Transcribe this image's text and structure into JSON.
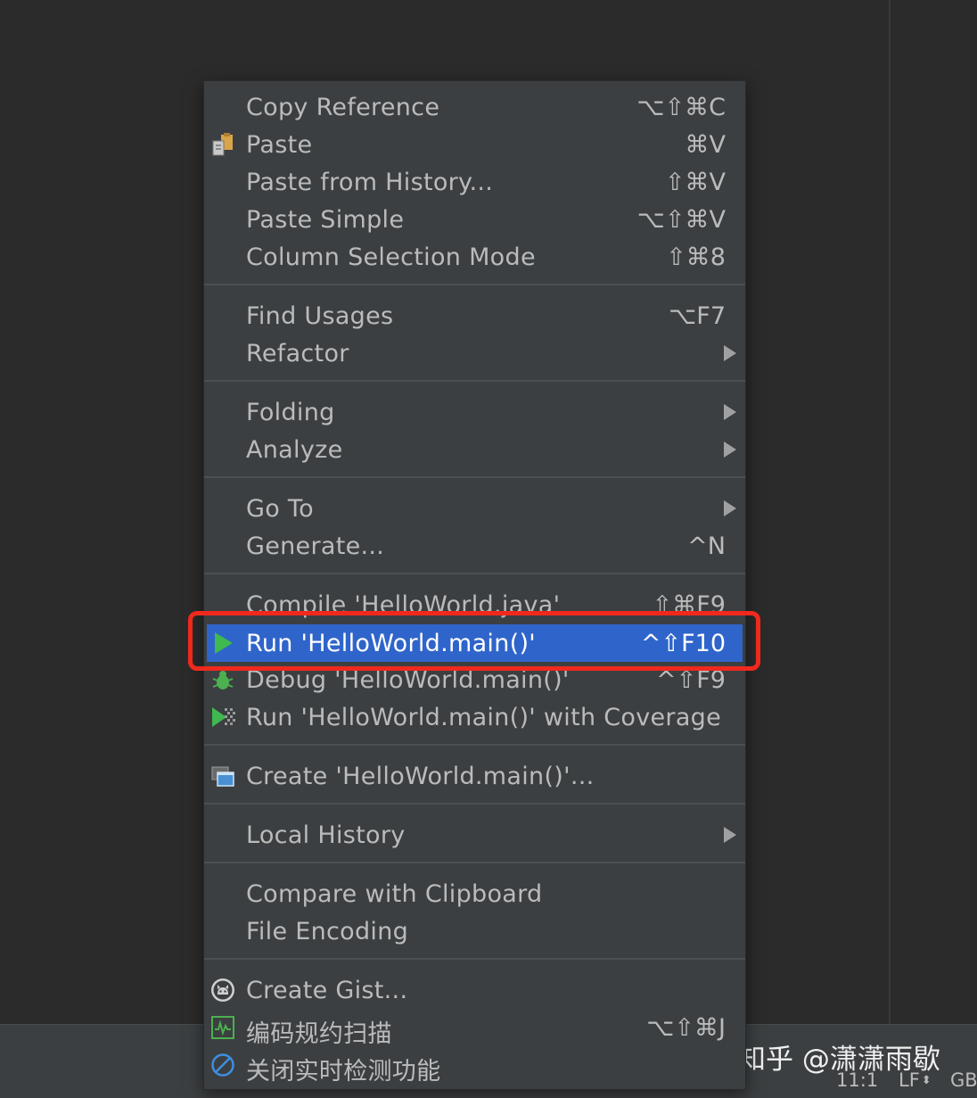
{
  "menu": {
    "items": [
      {
        "label": "Copy Reference",
        "shortcut": "⌥⇧⌘C"
      },
      {
        "label": "Paste",
        "shortcut": "⌘V",
        "icon": "clipboard-paste-icon"
      },
      {
        "label": "Paste from History...",
        "shortcut": "⇧⌘V"
      },
      {
        "label": "Paste Simple",
        "shortcut": "⌥⇧⌘V"
      },
      {
        "label": "Column Selection Mode",
        "shortcut": "⇧⌘8"
      },
      {
        "label": "Find Usages",
        "shortcut": "⌥F7"
      },
      {
        "label": "Refactor",
        "submenu": true
      },
      {
        "label": "Folding",
        "submenu": true
      },
      {
        "label": "Analyze",
        "submenu": true
      },
      {
        "label": "Go To",
        "submenu": true
      },
      {
        "label": "Generate...",
        "shortcut": "^N"
      },
      {
        "label": "Compile 'HelloWorld.java'",
        "shortcut": "⇧⌘F9"
      },
      {
        "label": "Run 'HelloWorld.main()'",
        "shortcut": "^⇧F10",
        "icon": "run-play-icon",
        "selected": true
      },
      {
        "label": "Debug 'HelloWorld.main()'",
        "shortcut": "^⇧F9",
        "icon": "debug-bug-icon"
      },
      {
        "label": "Run 'HelloWorld.main()' with Coverage",
        "icon": "run-coverage-icon"
      },
      {
        "label": "Create 'HelloWorld.main()'...",
        "icon": "run-configuration-icon"
      },
      {
        "label": "Local History",
        "submenu": true
      },
      {
        "label": "Compare with Clipboard"
      },
      {
        "label": "File Encoding"
      },
      {
        "label": "Create Gist...",
        "icon": "github-octocat-icon"
      },
      {
        "label": "编码规约扫描",
        "shortcut": "⌥⇧⌘J",
        "icon": "code-scan-icon"
      },
      {
        "label": "关闭实时检测功能",
        "icon": "disable-realtime-icon"
      }
    ]
  },
  "statusbar": {
    "position": "11:1",
    "line_separator": "LF",
    "encoding": "GB"
  },
  "watermark": "知乎 @潇潇雨歇",
  "colors": {
    "menu_background": "#3c3f41",
    "selection": "#2f65ca",
    "highlight_box": "#f0291d",
    "editor_background": "#2b2b2b"
  }
}
